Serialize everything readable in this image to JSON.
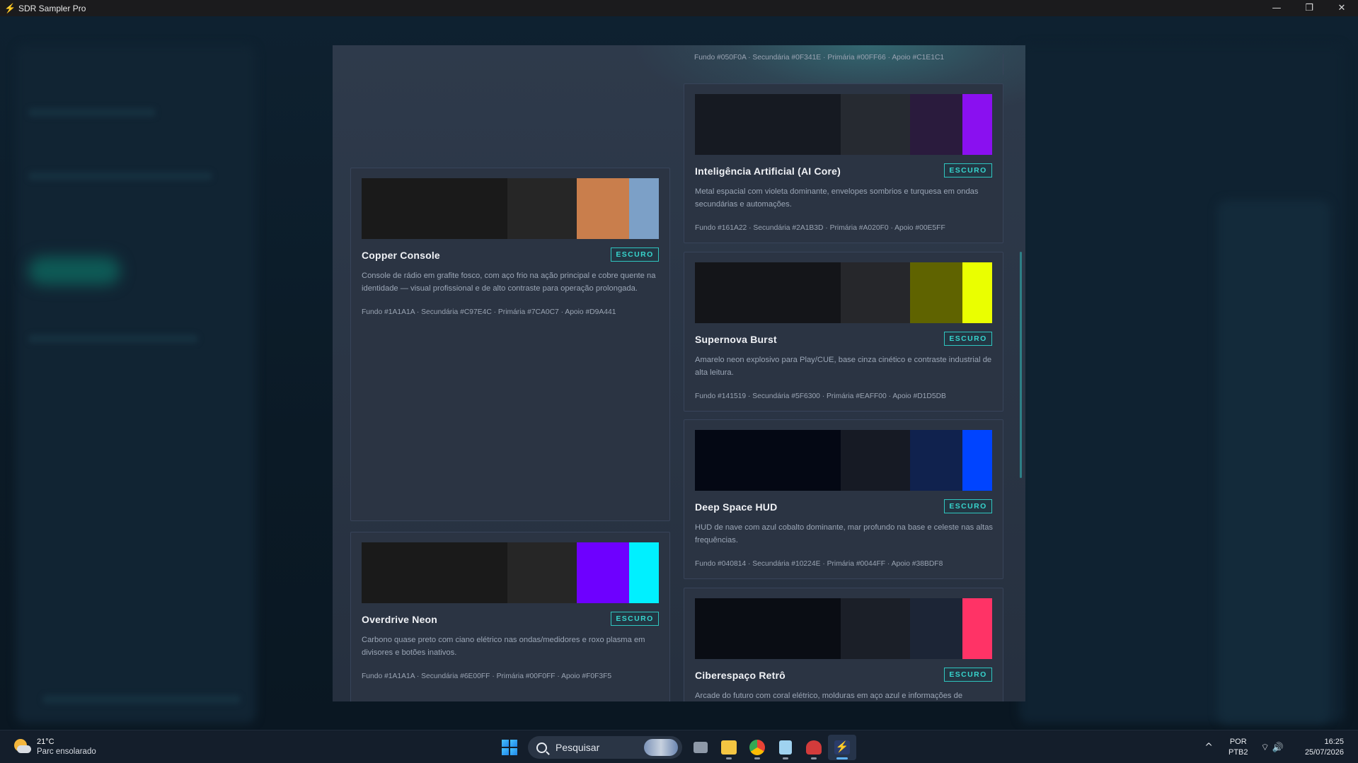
{
  "window": {
    "title": "SDR Sampler Pro",
    "minimize": "—",
    "maximize": "❐",
    "close": "✕"
  },
  "top_card_codes": "Fundo #050F0A · Secundária #0F341E · Primária #00FF66 · Apoio #C1E1C1",
  "cards_left": [
    {
      "name": "Copper Console",
      "badge": "ESCURO",
      "desc": "Console de rádio em grafite fosco, com aço frio na ação principal e cobre quente na identidade — visual profissional e de alto contraste para operação prolongada.",
      "codes": "Fundo #1A1A1A · Secundária #C97E4C · Primária #7CA0C7 · Apoio #D9A441",
      "swatches": [
        "#1a1a1a",
        "#262626",
        "#c97e4c",
        "#7ca0c7"
      ]
    },
    {
      "name": "Overdrive Neon",
      "badge": "ESCURO",
      "desc": "Carbono quase preto com ciano elétrico nas ondas/medidores e roxo plasma em divisores e botões inativos.",
      "codes": "Fundo #1A1A1A · Secundária #6E00FF · Primária #00F0FF · Apoio #F0F3F5",
      "swatches": [
        "#1a1a1a",
        "#262626",
        "#6e00ff",
        "#00f0ff"
      ]
    }
  ],
  "cards_right": [
    {
      "name": "Inteligência Artificial (AI Core)",
      "badge": "ESCURO",
      "desc": "Metal espacial com violeta dominante, envelopes sombrios e turquesa em ondas secundárias e automações.",
      "codes": "Fundo #161A22 · Secundária #2A1B3D · Primária #A020F0 · Apoio #00E5FF",
      "swatches": [
        "#161a22",
        "#262a31",
        "#2a1b3d",
        "#8a10f0"
      ]
    },
    {
      "name": "Supernova Burst",
      "badge": "ESCURO",
      "desc": "Amarelo neon explosivo para Play/CUE, base cinza cinético e contraste industrial de alta leitura.",
      "codes": "Fundo #141519 · Secundária #5F6300 · Primária #EAFF00 · Apoio #D1D5DB",
      "swatches": [
        "#141519",
        "#26272b",
        "#5f6300",
        "#eaff00"
      ]
    },
    {
      "name": "Deep Space HUD",
      "badge": "ESCURO",
      "desc": "HUD de nave com azul cobalto dominante, mar profundo na base e celeste nas altas frequências.",
      "codes": "Fundo #040814 · Secundária #10224E · Primária #0044FF · Apoio #38BDF8",
      "swatches": [
        "#040814",
        "#161a24",
        "#10224e",
        "#0044ff"
      ]
    },
    {
      "name": "Ciberespaço Retrô",
      "badge": "ESCURO",
      "desc": "Arcade do futuro com coral elétrico, molduras em aço azul e informações de",
      "codes": "",
      "swatches": [
        "#0a0d14",
        "#1b1f28",
        "#1c2536",
        "#ff3366"
      ]
    }
  ],
  "taskbar": {
    "weather_temp": "21°C",
    "weather_desc": "Parc ensolarado",
    "search_placeholder": "Pesquisar",
    "lang_1": "POR",
    "lang_2": "PTB2",
    "time": "16:25",
    "date": "25/07/2026",
    "chevron": "^",
    "sys_icons": "⌔🔊"
  }
}
